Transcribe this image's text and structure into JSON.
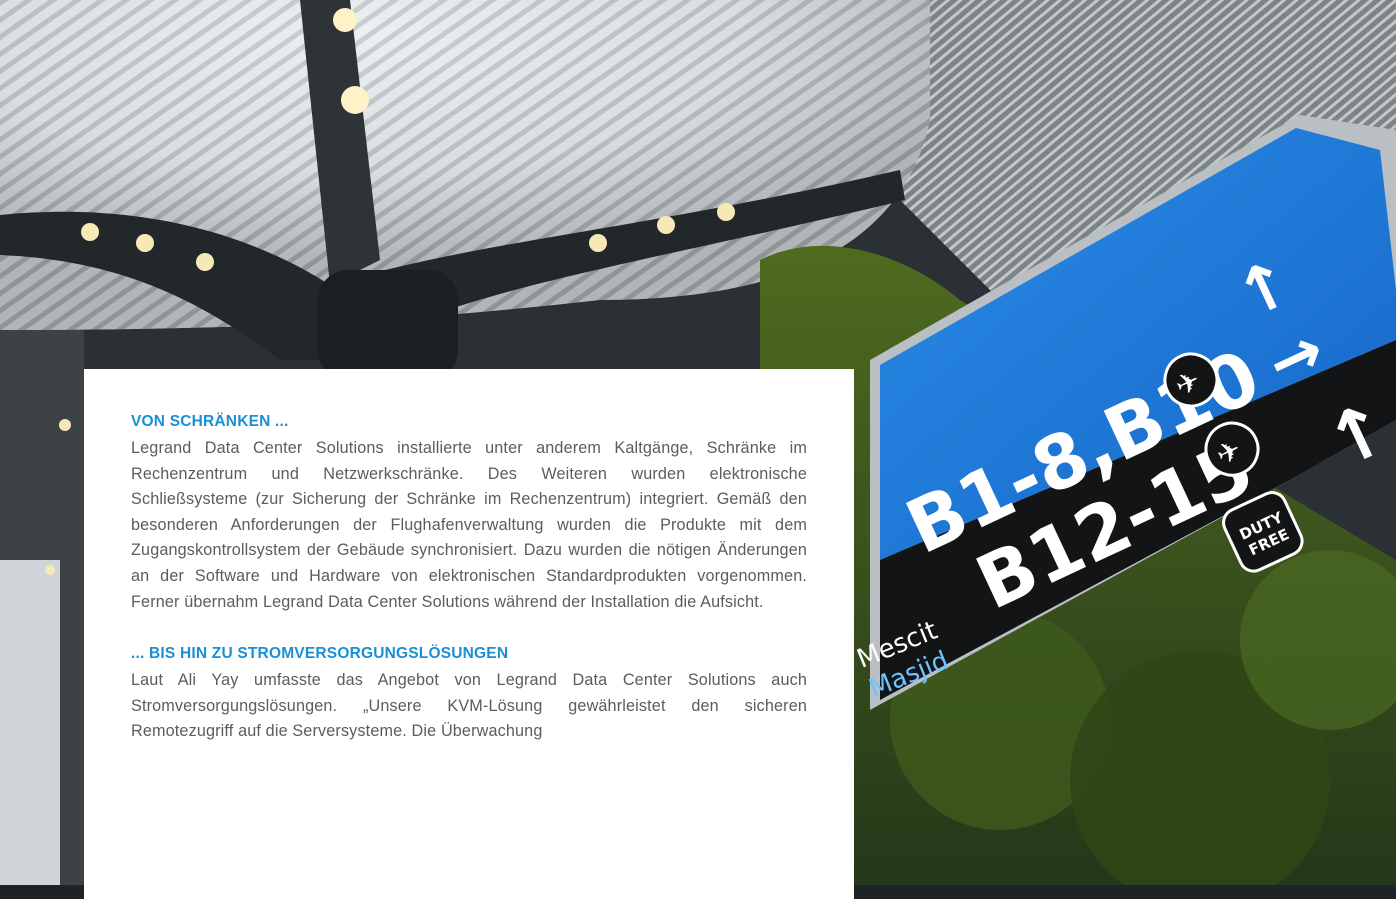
{
  "photo": {
    "description_icon": "airport-terminal-photo",
    "sign": {
      "line1": "B1-8,B10",
      "line2": "B12-15",
      "duty_free_line1": "DUTY",
      "duty_free_line2": "FREE",
      "mescit": "Mescit",
      "masjid": "Masjid",
      "bg_color": "#1f7fd8"
    }
  },
  "article": {
    "section1": {
      "heading": "VON SCHRÄNKEN ...",
      "body": "Legrand Data Center Solutions installierte unter anderem Kaltgänge, Schränke im Rechenzentrum und Netzwerkschränke. Des Weiteren wurden elektronische Schließsysteme (zur Sicherung der Schränke im Rechenzentrum) integriert. Gemäß den besonderen Anforderungen der Flughafenverwaltung wurden die Produkte mit dem Zugangskontrollsystem der Gebäude synchronisiert. Dazu wurden die nötigen Änderungen an der Software und Hardware von elektronischen Standardprodukten vorgenommen. Ferner übernahm Legrand Data Center Solutions während der Installation die Aufsicht."
    },
    "section2": {
      "heading": "... BIS HIN ZU STROMVERSORGUNGSLÖSUNGEN",
      "body": "Laut Ali Yay umfasste das Angebot von Legrand Data Center Solutions auch Stromversorgungslösungen. „Unsere KVM-Lösung gewährleistet den sicheren Remotezugriff auf die Serversysteme. Die Überwachung"
    },
    "heading_color": "#1a8fd6"
  }
}
